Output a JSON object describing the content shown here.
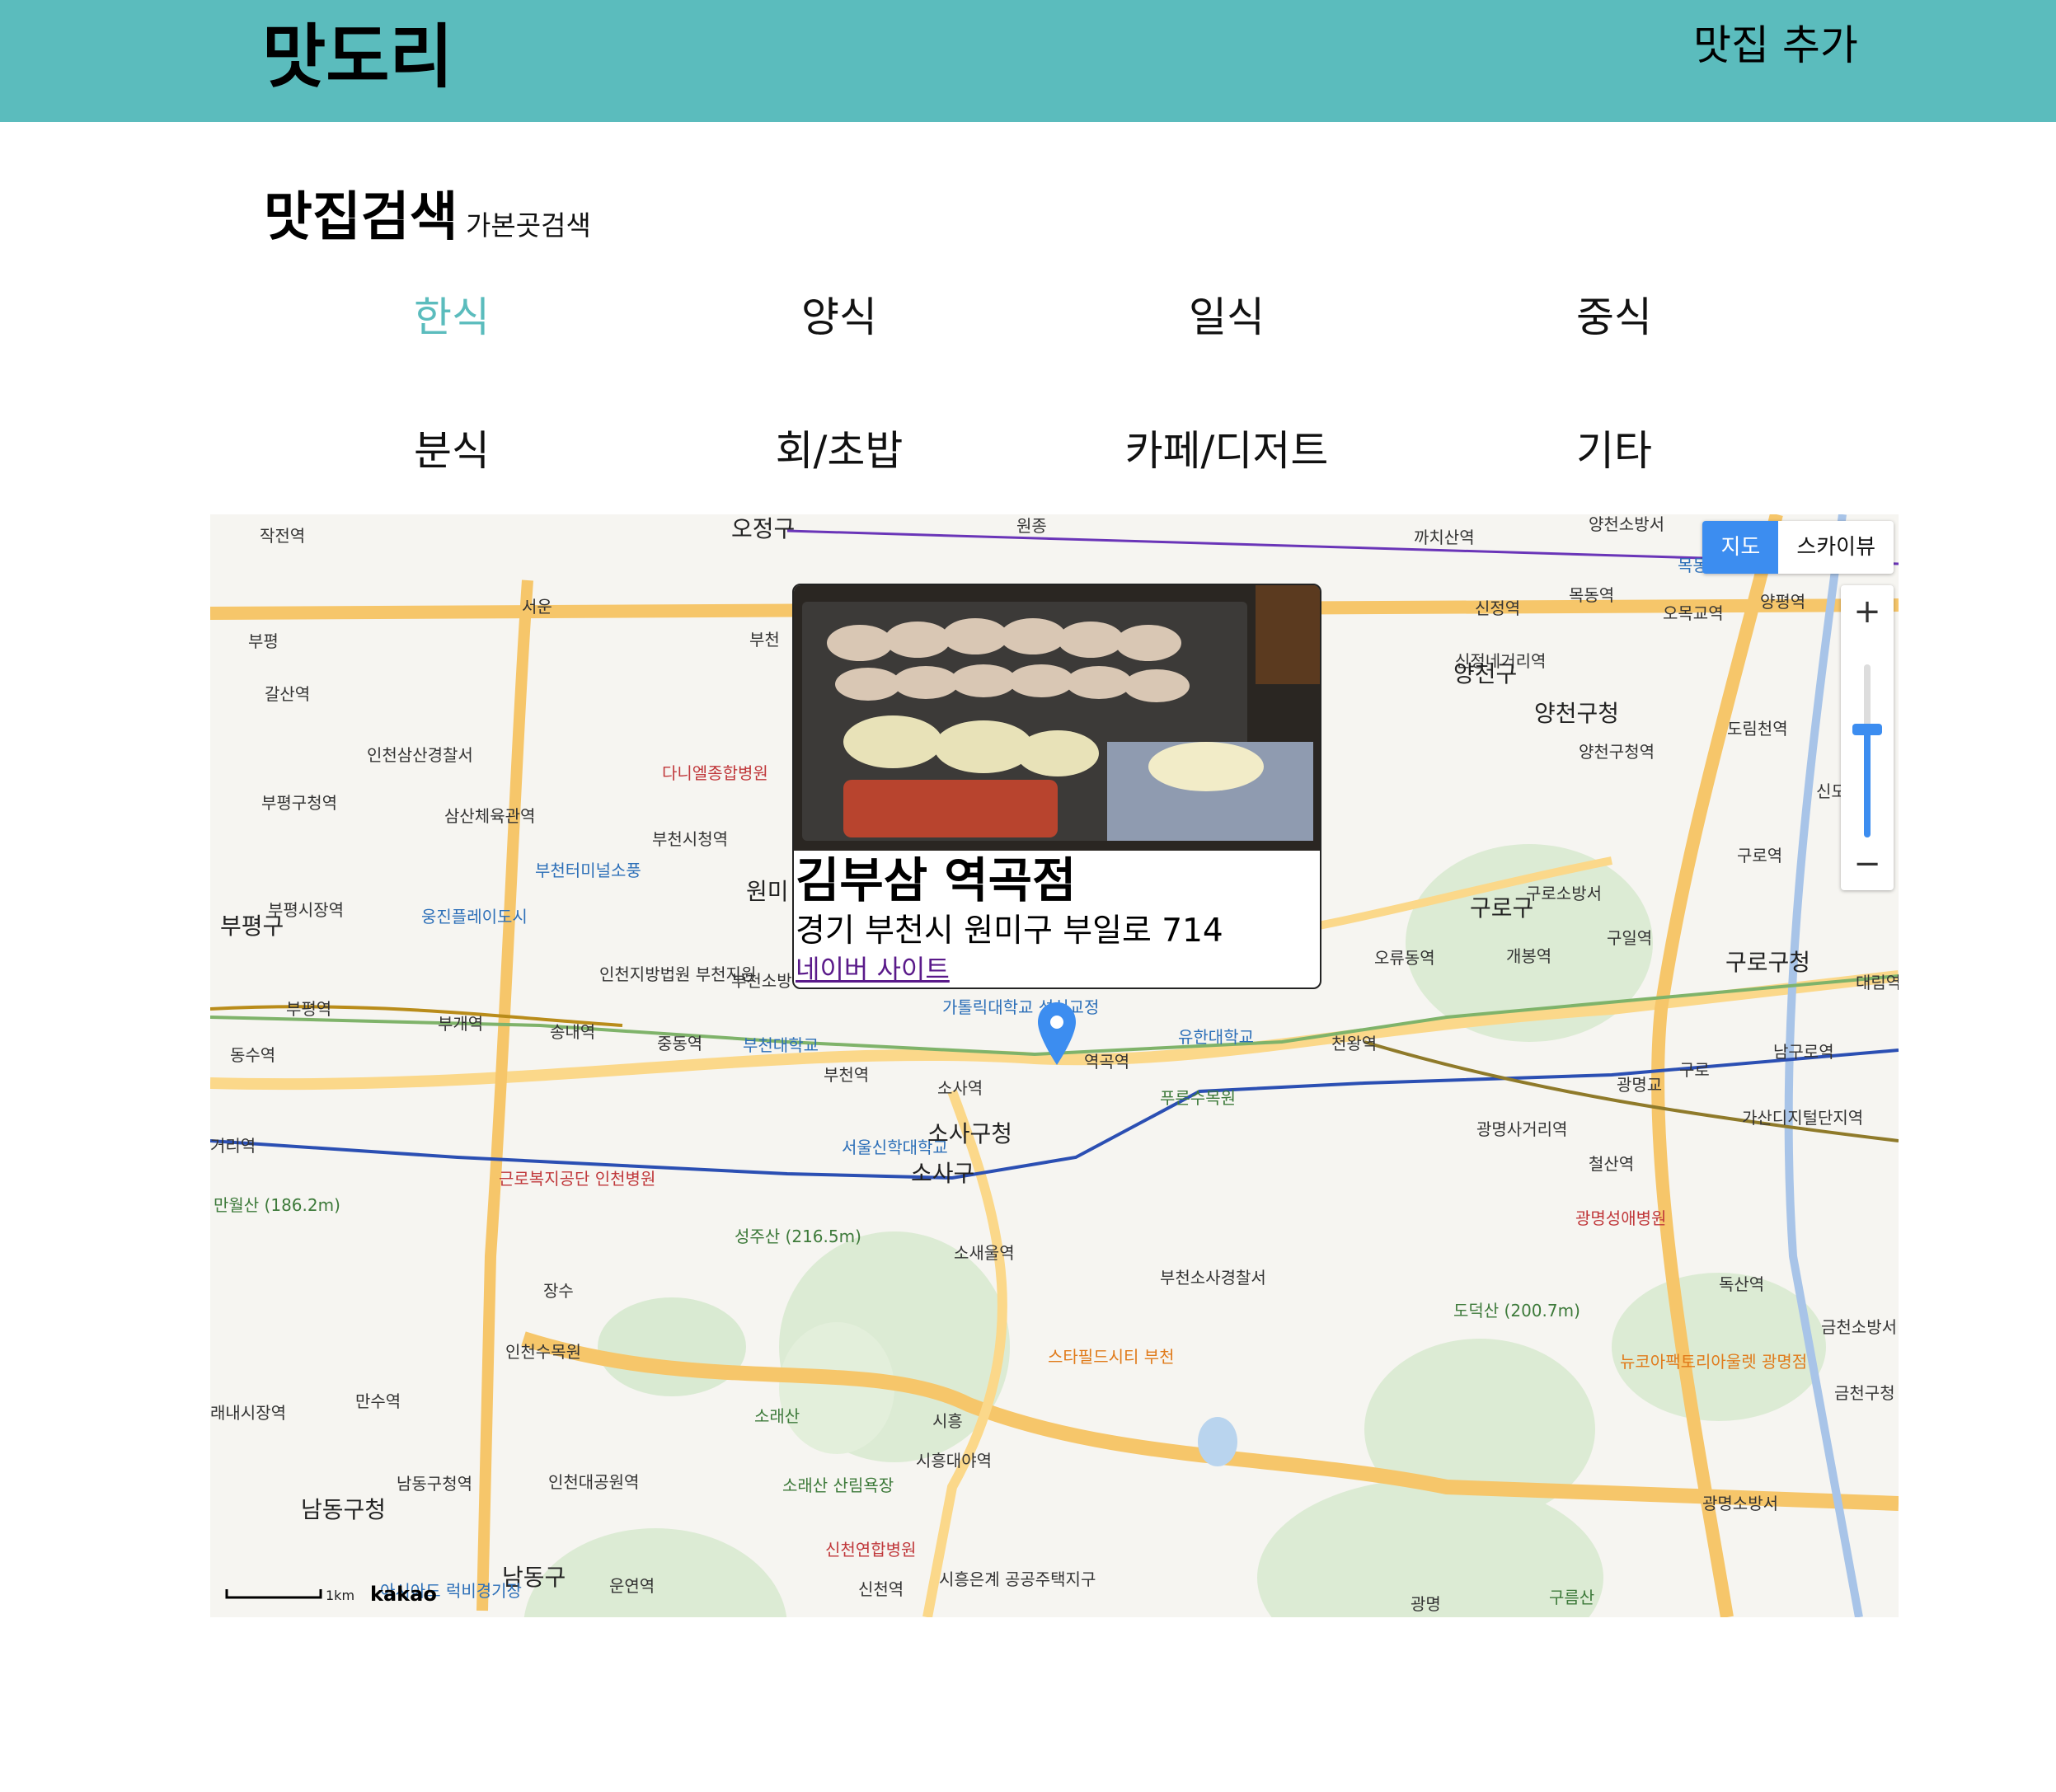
{
  "header": {
    "logo": "맛도리",
    "add_button": "맛집 추가"
  },
  "search": {
    "title": "맛집검색",
    "subtitle": "가본곳검색"
  },
  "categories": [
    {
      "label": "한식",
      "active": true
    },
    {
      "label": "양식",
      "active": false
    },
    {
      "label": "일식",
      "active": false
    },
    {
      "label": "중식",
      "active": false
    },
    {
      "label": "분식",
      "active": false
    },
    {
      "label": "회/초밥",
      "active": false
    },
    {
      "label": "카페/디저트",
      "active": false
    },
    {
      "label": "기타",
      "active": false
    }
  ],
  "colors": {
    "accent": "#5bbcbd",
    "map_button": "#3c8df0",
    "link": "#5a1a8a"
  },
  "map": {
    "type_buttons": {
      "map": "지도",
      "skyview": "스카이뷰"
    },
    "zoom_in": "+",
    "zoom_out": "−",
    "scale_label": "1km",
    "provider": "kakao",
    "info": {
      "name": "김부삼 역곡점",
      "address": "경기 부천시 원미구 부일로 714",
      "link_text": "네이버 사이트"
    },
    "labels": {
      "l1": "작전역",
      "l2": "오정구",
      "l3": "원종",
      "l4": "까치산역",
      "l5": "양천소방서",
      "l6": "부평",
      "l7": "서운",
      "l8": "부천",
      "l9": "신정역",
      "l10": "목동역",
      "l11": "오목교역",
      "l12": "양평역",
      "l13": "갈산역",
      "l14": "신정네거리역",
      "l15": "양천구",
      "l16": "양천구청",
      "l17": "도림천역",
      "l18": "인천삼산경찰서",
      "l19": "다니엘종합병원",
      "l20": "양천구청역",
      "l21": "부평구청역",
      "l22": "삼산체육관역",
      "l23": "부천시청역",
      "l24": "신도림역",
      "l25": "구로역",
      "l26": "부천터미널소풍",
      "l27": "원미",
      "l28": "구로소방서",
      "l29": "부평시장역",
      "l30": "구로구",
      "l31": "부평구",
      "l32": "웅진플레이도시",
      "l33": "인천지방법원 부천지원",
      "l34": "부천소방서",
      "l35": "오류동역",
      "l36": "개봉역",
      "l37": "구일역",
      "l38": "구로구청",
      "l39": "대림역",
      "l40": "부평역",
      "l41": "부개역",
      "l42": "송내역",
      "l43": "중동역",
      "l44": "부천대학교",
      "l45": "가톨릭대학교 성심교정",
      "l46": "유한대학교",
      "l47": "천왕역",
      "l48": "남구로역",
      "l49": "동수역",
      "l50": "부천역",
      "l51": "소사역",
      "l52": "역곡역",
      "l53": "푸른수목원",
      "l54": "광명교",
      "l55": "구로",
      "l56": "가산디지털단지역",
      "l57": "서울신학대학교",
      "l58": "소사구청",
      "l59": "소사구",
      "l60": "광명사거리역",
      "l61": "철산역",
      "l62": "근로복지공단 인천병원",
      "l63": "만월산 (186.2m)",
      "l64": "성주산 (216.5m)",
      "l65": "광명성애병원",
      "l66": "소새울역",
      "l67": "부천소사경찰서",
      "l68": "도덕산 (200.7m)",
      "l69": "독산역",
      "l70": "장수",
      "l71": "인천수목원",
      "l72": "스타필드시티 부천",
      "l73": "금천소방서",
      "l74": "뉴코아팩토리아울렛 광명점",
      "l75": "금천구청",
      "l76": "만수역",
      "l77": "소래산",
      "l78": "시흥",
      "l79": "시흥대야역",
      "l80": "남동구청역",
      "l81": "인천대공원역",
      "l82": "소래산 산림욕장",
      "l83": "광명소방서",
      "l84": "남동구청",
      "l85": "신천연합병원",
      "l86": "남동구",
      "l87": "운연역",
      "l88": "신천역",
      "l89": "시흥은계 공공주택지구",
      "l90": "광명",
      "l91": "구름산",
      "l92": "아시아드 럭비경기장",
      "l93": "목동",
      "l94": "거리역",
      "l95": "래내시장역"
    }
  }
}
